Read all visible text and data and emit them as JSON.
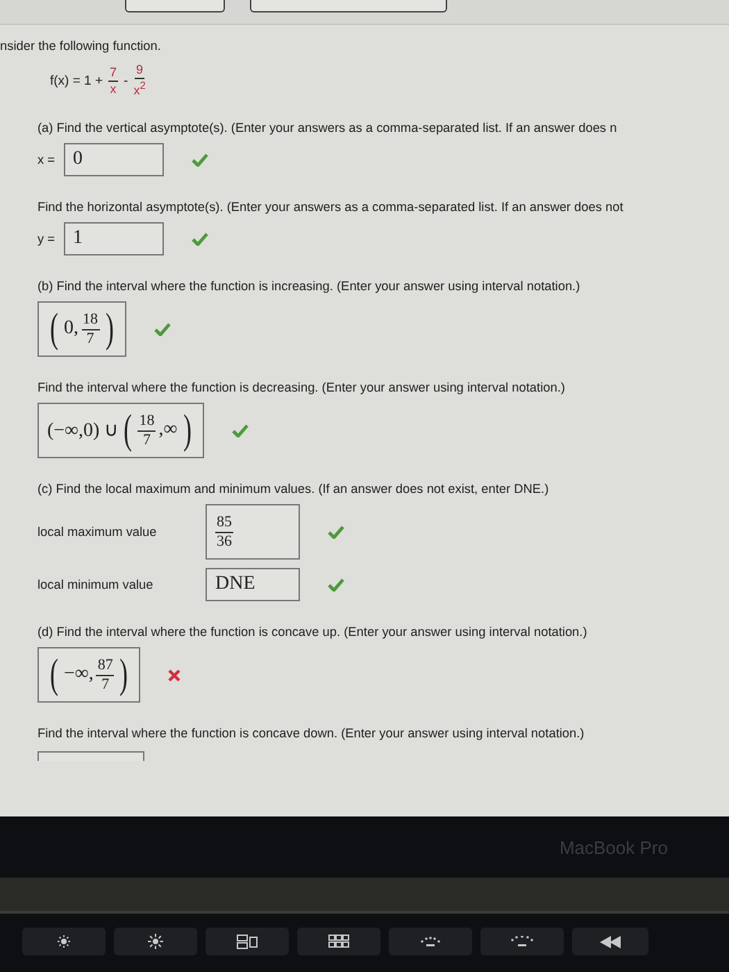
{
  "intro": "nsider the following function.",
  "formula": [
    {
      "kind": "text",
      "text": "f(x) = 1 +"
    },
    {
      "kind": "frac",
      "num": "7",
      "den": "x"
    },
    {
      "kind": "text",
      "text": "-"
    },
    {
      "kind": "frac",
      "num": "9",
      "den": "x$^{2}$"
    }
  ],
  "items": [
    {
      "kind": "question",
      "text": "(a) Find the vertical asymptote(s). (Enter your answers as a comma-separated list. If an answer does n"
    },
    {
      "kind": "answer",
      "label": "x =",
      "correct": true,
      "value": [
        {
          "kind": "text",
          "text": "0"
        }
      ]
    },
    {
      "kind": "question",
      "text": "Find the horizontal asymptote(s). (Enter your answers as a comma-separated list. If an answer does not"
    },
    {
      "kind": "answer",
      "label": "y =",
      "correct": true,
      "value": [
        {
          "kind": "text",
          "text": "1"
        }
      ]
    },
    {
      "kind": "question",
      "text": "(b) Find the interval where the function is increasing. (Enter your answer using interval notation.)"
    },
    {
      "kind": "answer",
      "correct": true,
      "value": [
        {
          "kind": "paren",
          "text": "("
        },
        {
          "kind": "text",
          "text": "0,"
        },
        {
          "kind": "frac",
          "num": "18",
          "den": "7"
        },
        {
          "kind": "paren",
          "text": ")"
        }
      ]
    },
    {
      "kind": "question",
      "text": "Find the interval where the function is decreasing. (Enter your answer using interval notation.)"
    },
    {
      "kind": "answer",
      "correct": true,
      "value": [
        {
          "kind": "text",
          "text": "(−∞,0) ∪"
        },
        {
          "kind": "paren",
          "text": "("
        },
        {
          "kind": "frac",
          "num": "18",
          "den": "7"
        },
        {
          "kind": "text",
          "text": ",∞"
        },
        {
          "kind": "paren",
          "text": ")"
        }
      ]
    },
    {
      "kind": "question",
      "text": "(c) Find the local maximum and minimum values. (If an answer does not exist, enter DNE.)"
    },
    {
      "kind": "answer",
      "label": "local maximum value",
      "correct": true,
      "value": [
        {
          "kind": "frac",
          "num": "85",
          "den": "36"
        }
      ]
    },
    {
      "kind": "answer",
      "label": "local minimum value",
      "correct": true,
      "value": [
        {
          "kind": "text",
          "text": "DNE"
        }
      ]
    },
    {
      "kind": "question",
      "text": "(d) Find the interval where the function is concave up. (Enter your answer using interval notation.)"
    },
    {
      "kind": "answer",
      "correct": false,
      "value": [
        {
          "kind": "paren",
          "text": "("
        },
        {
          "kind": "text",
          "text": "−∞,"
        },
        {
          "kind": "frac",
          "num": "87",
          "den": "7"
        },
        {
          "kind": "paren",
          "text": ")"
        }
      ]
    },
    {
      "kind": "question",
      "text": "Find the interval where the function is concave down. (Enter your answer using interval notation.)"
    },
    {
      "kind": "cutoff"
    }
  ],
  "bezel_label": "MacBook Pro"
}
